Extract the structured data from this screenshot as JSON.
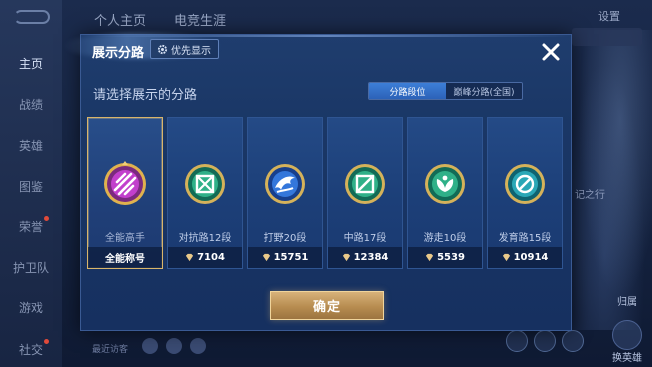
{
  "background": {
    "tabs": [
      "个人主页",
      "电竞生涯"
    ],
    "settings": "设置",
    "nav": [
      {
        "label": "主页",
        "active": true
      },
      {
        "label": "战绩",
        "active": false
      },
      {
        "label": "英雄",
        "active": false
      },
      {
        "label": "图鉴",
        "active": false
      },
      {
        "label": "荣誉",
        "active": false
      },
      {
        "label": "护卫队",
        "active": false
      },
      {
        "label": "游戏",
        "active": false
      },
      {
        "label": "社交",
        "active": false
      }
    ],
    "side_text": "记之行",
    "bottom_text": "最近访客",
    "right_label_mid": "归属",
    "right_label_bottom": "换英雄"
  },
  "modal": {
    "title": "展示分路",
    "priority_badge": "优先显示",
    "prompt": "请选择展示的分路",
    "segment": {
      "selected": "分路段位",
      "other": "巅峰分路(全国)"
    },
    "confirm": "确定",
    "cards": [
      {
        "id": "all",
        "label": "全能高手",
        "footer": "全能称号",
        "score": null,
        "selected": true,
        "color": "#c040c8"
      },
      {
        "id": "clash",
        "label": "对抗路12段",
        "footer": "7104",
        "score": 7104,
        "selected": false,
        "color": "#2aa37a"
      },
      {
        "id": "jungle",
        "label": "打野20段",
        "footer": "15751",
        "score": 15751,
        "selected": false,
        "color": "#2f6fd0"
      },
      {
        "id": "mid",
        "label": "中路17段",
        "footer": "12384",
        "score": 12384,
        "selected": false,
        "color": "#2aa37a"
      },
      {
        "id": "roam",
        "label": "游走10段",
        "footer": "5539",
        "score": 5539,
        "selected": false,
        "color": "#2aa37a"
      },
      {
        "id": "farm",
        "label": "发育路15段",
        "footer": "10914",
        "score": 10914,
        "selected": false,
        "color": "#2a9fb0"
      }
    ]
  },
  "icons": {
    "close": "close-icon",
    "gear": "gear-icon",
    "score": "diamond-score-icon"
  }
}
